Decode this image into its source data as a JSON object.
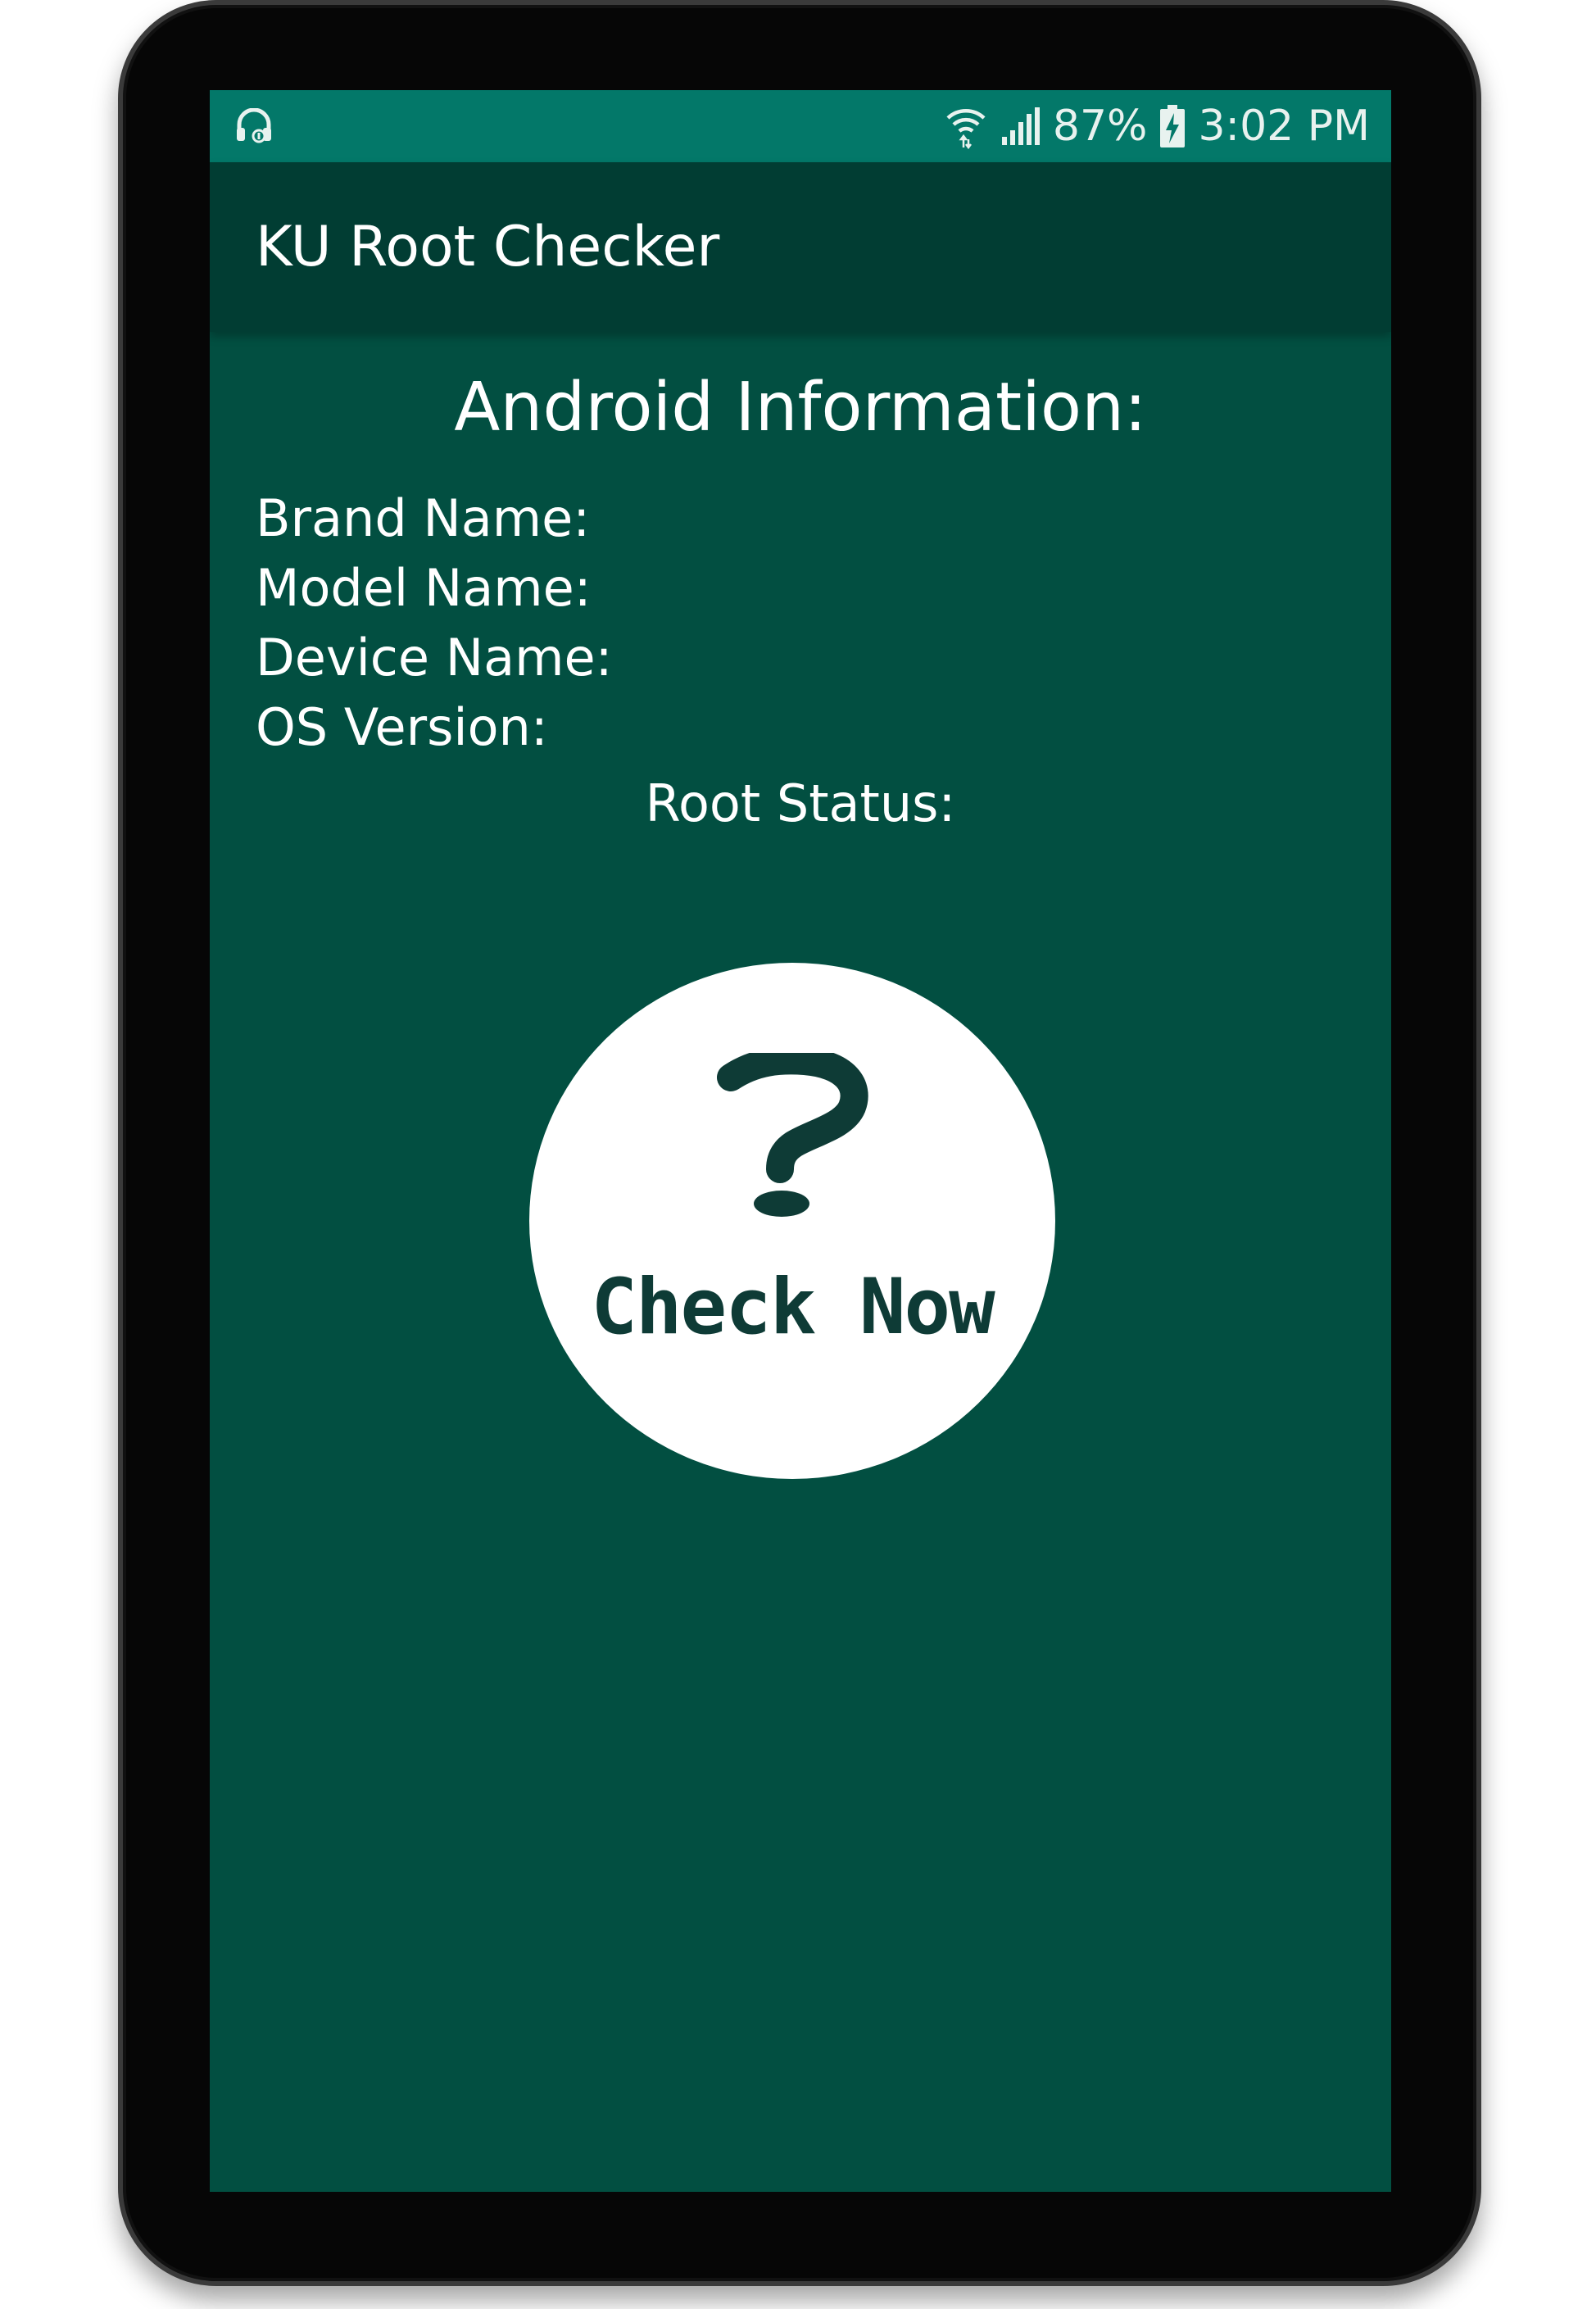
{
  "status_bar": {
    "left_icon": "headset-icon",
    "wifi_icon": "wifi-icon",
    "signal_icon": "signal-icon",
    "battery_percent": "87%",
    "battery_icon": "battery-charging-icon",
    "time": "3:02 PM"
  },
  "app_bar": {
    "title": "KU Root Checker"
  },
  "info": {
    "heading": "Android Information:",
    "brand_label": "Brand Name:",
    "model_label": "Model Name:",
    "device_label": "Device Name:",
    "os_label": "OS Version:",
    "root_status_label": "Root Status:"
  },
  "check_button": {
    "icon": "question-mark-icon",
    "label": "Check Now"
  },
  "colors": {
    "screen_background": "#024f41",
    "status_bar": "#037869",
    "app_bar": "#013d33",
    "button_background": "#ffffff",
    "button_text": "#0e3b36"
  }
}
